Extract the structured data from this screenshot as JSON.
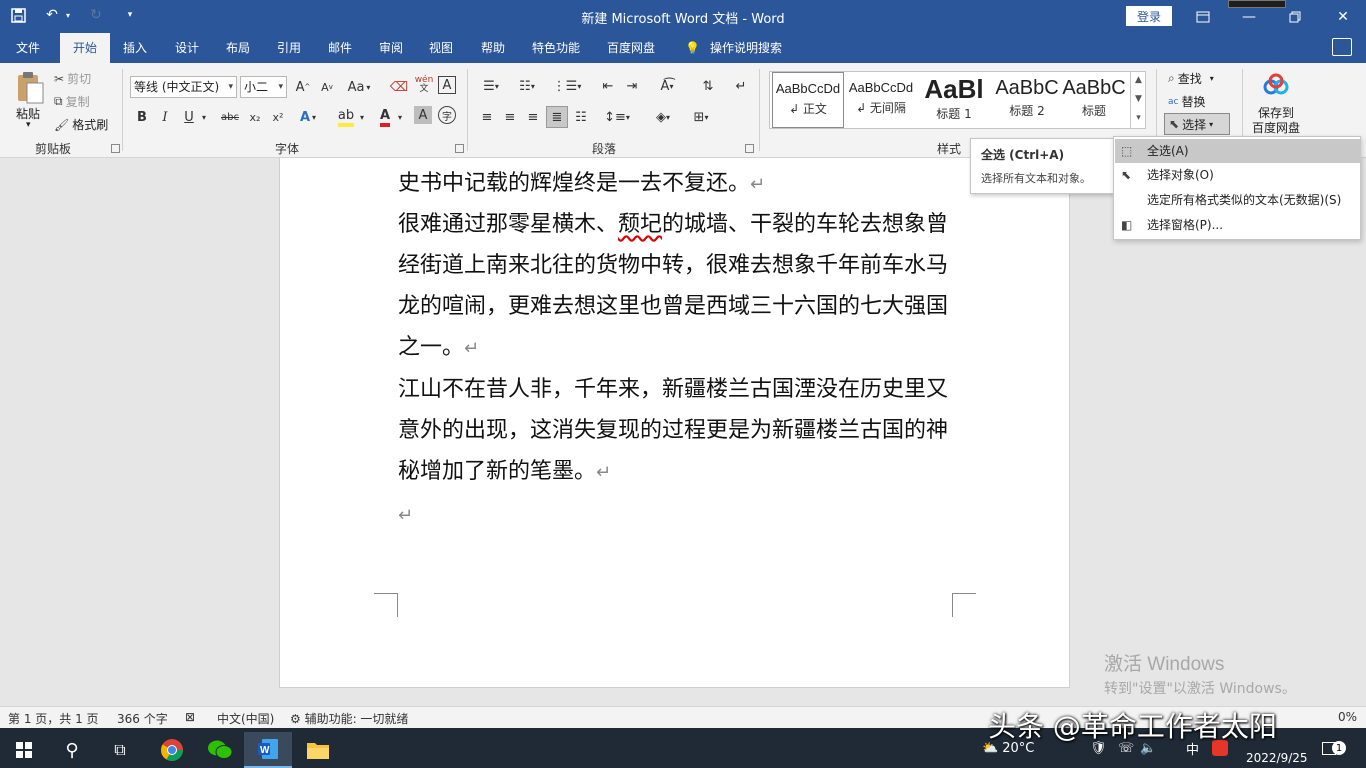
{
  "window": {
    "title": "新建 Microsoft Word 文档  -  Word",
    "login_label": "登录"
  },
  "tabs": [
    "文件",
    "开始",
    "插入",
    "设计",
    "布局",
    "引用",
    "邮件",
    "审阅",
    "视图",
    "帮助",
    "特色功能",
    "百度网盘",
    "操作说明搜索"
  ],
  "clipboard": {
    "paste": "粘贴",
    "cut": "剪切",
    "copy": "复制",
    "format_painter": "格式刷",
    "group": "剪贴板"
  },
  "font": {
    "name": "等线 (中文正文)",
    "size": "小二",
    "group": "字体",
    "aa": "Aa",
    "wen": "wén",
    "a_box": "A",
    "bold": "B",
    "italic": "I",
    "underline": "U",
    "strike": "abc",
    "sub": "x₂",
    "sup": "x²",
    "grow": "A",
    "shrink": "A",
    "color_a": "A",
    "shade_a": "A",
    "circle": "字"
  },
  "paragraph": {
    "group": "段落"
  },
  "styles": {
    "group": "样式",
    "items": [
      {
        "sample": "AaBbCcDd",
        "name": "↲ 正文"
      },
      {
        "sample": "AaBbCcDd",
        "name": "↲ 无间隔"
      },
      {
        "sample": "AaBl",
        "name": "标题 1"
      },
      {
        "sample": "AaBbC",
        "name": "标题 2"
      },
      {
        "sample": "AaBbC",
        "name": "标题"
      }
    ]
  },
  "editing": {
    "find": "查找",
    "replace": "替换",
    "select": "选择"
  },
  "baidu": {
    "save_line1": "保存到",
    "save_line2": "百度网盘"
  },
  "document": {
    "paragraphs": [
      "史书中记载的辉煌终是一去不复还。",
      "很难通过那零星横木、",
      "颓圮",
      "的城墙、干裂的车轮去想象曾经街道上南来北往的货物中转，很难去想象千年前车水马龙的喧闹，更难去想这里也曾是西域三十六国的七大强国之一。",
      "江山不在昔人非，千年来，新疆楼兰古国湮没在历史里又意外的出现，这消失复现的过程更是为新疆楼兰古国的神秘增加了新的笔墨。"
    ],
    "para_mark": "↵"
  },
  "tooltip": {
    "title": "全选 (Ctrl+A)",
    "desc": "选择所有文本和对象。"
  },
  "select_menu": {
    "items": [
      {
        "label": "全选(A)",
        "icon": "select-all-icon"
      },
      {
        "label": "选择对象(O)",
        "icon": "pointer-icon"
      },
      {
        "label": "选定所有格式类似的文本(无数据)(S)",
        "icon": ""
      },
      {
        "label": "选择窗格(P)...",
        "icon": "selection-pane-icon"
      }
    ]
  },
  "watermark": {
    "line1": "激活 Windows",
    "line2": "转到\"设置\"以激活 Windows。"
  },
  "status": {
    "page": "第 1 页，共 1 页",
    "words": "366 个字",
    "lang": "中文(中国)",
    "access": "辅助功能: 一切就绪",
    "zoom": "0%"
  },
  "taskbar": {
    "temp": "20°C",
    "ime": "中",
    "date": "2022/9/25",
    "notif": "1"
  },
  "overlay": "头条 @革命工作者太阳"
}
